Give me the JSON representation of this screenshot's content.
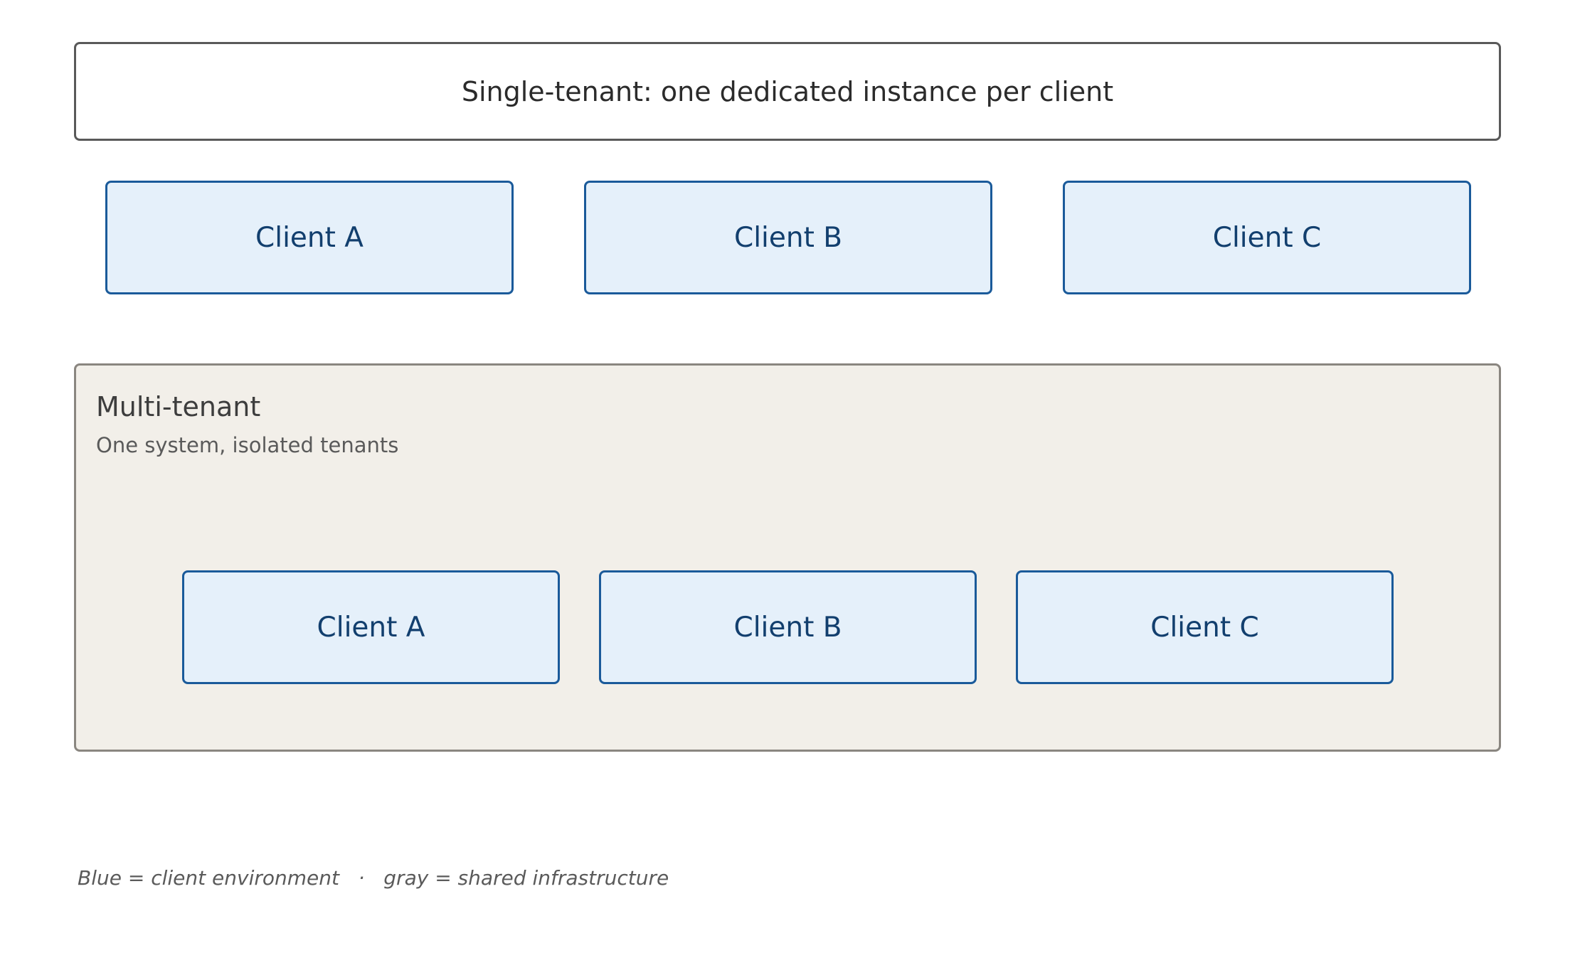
{
  "single_tenant": {
    "title": "Single-tenant: one dedicated instance per client",
    "clients": [
      "Client A",
      "Client B",
      "Client C"
    ]
  },
  "multi_tenant": {
    "title": "Multi-tenant",
    "subtitle": "One system, isolated tenants",
    "clients": [
      "Client A",
      "Client B",
      "Client C"
    ]
  },
  "legend": {
    "blue_text": "Blue = client environment",
    "separator": "·",
    "gray_text": "gray = shared infrastructure"
  },
  "colors": {
    "client_border": "#1a5a9a",
    "client_fill": "#e5f0fa",
    "shared_border": "#8a8680",
    "shared_fill": "#f2efe9"
  }
}
